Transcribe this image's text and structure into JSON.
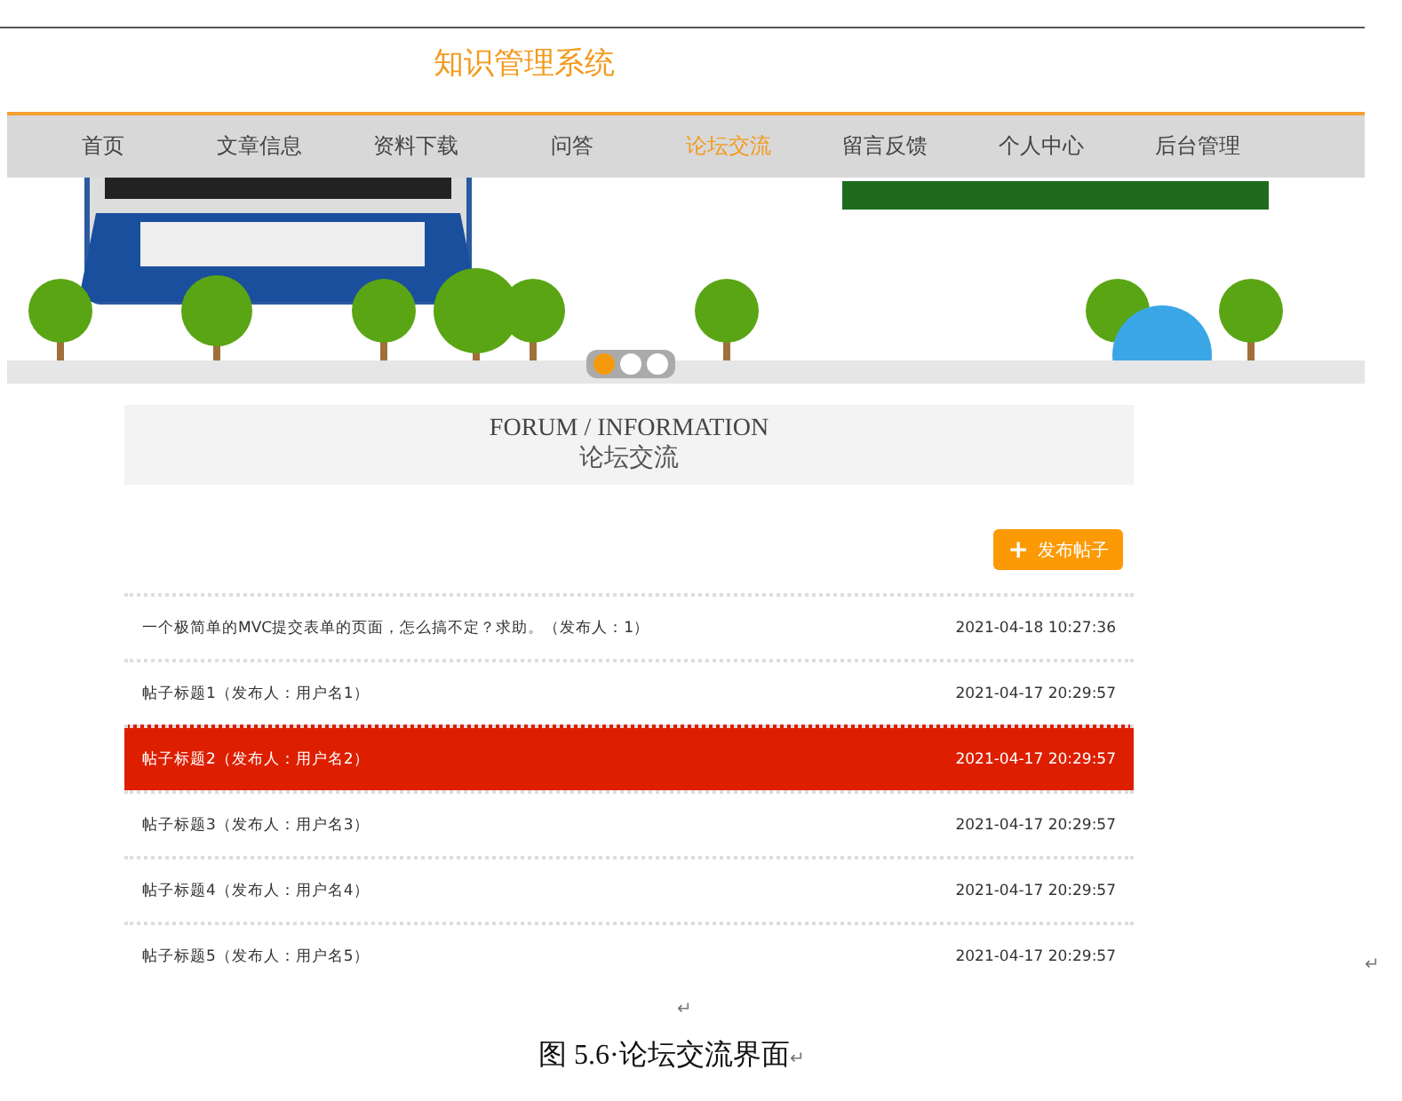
{
  "site_title": "知识管理系统",
  "nav": [
    {
      "label": "首页",
      "selected": false
    },
    {
      "label": "文章信息",
      "selected": false
    },
    {
      "label": "资料下载",
      "selected": false
    },
    {
      "label": "问答",
      "selected": false
    },
    {
      "label": "论坛交流",
      "selected": true
    },
    {
      "label": "留言反馈",
      "selected": false
    },
    {
      "label": "个人中心",
      "selected": false
    },
    {
      "label": "后台管理",
      "selected": false
    }
  ],
  "banner": {
    "kind": "picture",
    "dots": [
      {
        "selected": true
      },
      {
        "selected": false
      },
      {
        "selected": false
      }
    ]
  },
  "section": {
    "title_en": "FORUM / INFORMATION",
    "title_zh": "论坛交流"
  },
  "post_button": {
    "icon": "+",
    "label": "发布帖子"
  },
  "posts": [
    {
      "title": "一个极简单的MVC提交表单的页面，怎么搞不定？求助。（发布人：1）",
      "time": "2021-04-18 10:27:36",
      "selected": false
    },
    {
      "title": "帖子标题1（发布人：用户名1）",
      "time": "2021-04-17 20:29:57",
      "selected": false
    },
    {
      "title": "帖子标题2（发布人：用户名2）",
      "time": "2021-04-17 20:29:57",
      "selected": true
    },
    {
      "title": "帖子标题3（发布人：用户名3）",
      "time": "2021-04-17 20:29:57",
      "selected": false
    },
    {
      "title": "帖子标题4（发布人：用户名4）",
      "time": "2021-04-17 20:29:57",
      "selected": false
    },
    {
      "title": "帖子标题5（发布人：用户名5）",
      "time": "2021-04-17 20:29:57",
      "selected": false
    }
  ],
  "document": {
    "caption": "图 5.6·论坛交流界面",
    "paragraph_mark": "↵"
  }
}
